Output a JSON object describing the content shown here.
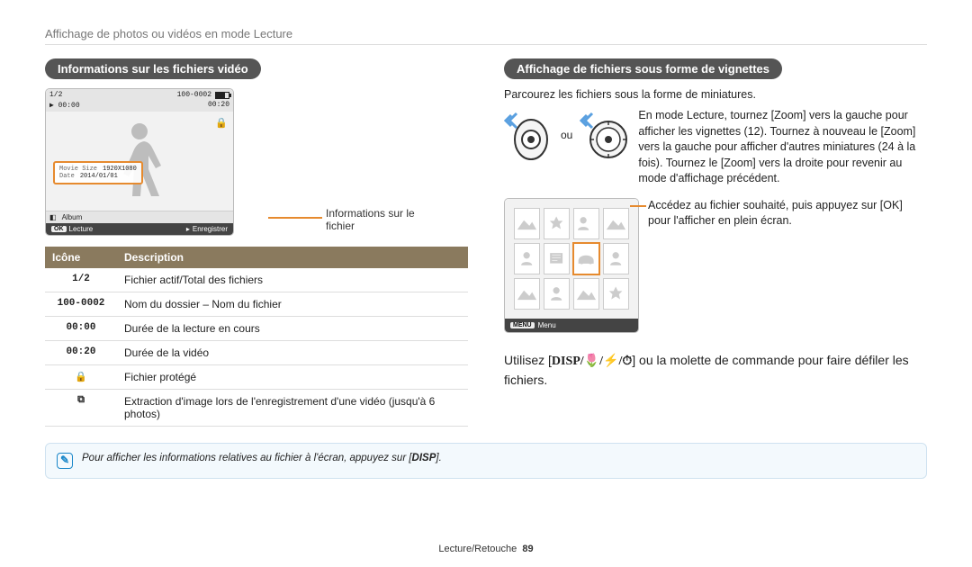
{
  "breadcrumb": "Affichage de photos ou vidéos en mode Lecture",
  "left": {
    "heading": "Informations sur les fichiers vidéo",
    "preview": {
      "index": "1/2",
      "folderfile": "100-0002",
      "elapsed": "00:00",
      "total": "00:20",
      "movie_label": "Movie Size",
      "movie_value": "1920X1080",
      "date_label": "Date",
      "date_value": "2014/01/01",
      "album": "Album",
      "play_key": "OK",
      "play_label": "Lecture",
      "save_label": "Enregistrer"
    },
    "callout": "Informations sur le\nfichier",
    "table": {
      "head_icon": "Icône",
      "head_desc": "Description",
      "rows": [
        {
          "icon": "1/2",
          "desc": "Fichier actif/Total des fichiers"
        },
        {
          "icon": "100-0002",
          "desc": "Nom du dossier – Nom du fichier"
        },
        {
          "icon": "00:00",
          "desc": "Durée de la lecture en cours"
        },
        {
          "icon": "00:20",
          "desc": "Durée de la vidéo"
        },
        {
          "icon": "🔒",
          "desc": "Fichier protégé"
        },
        {
          "icon": "⧉",
          "desc": "Extraction d'image lors de l'enregistrement d'une vidéo (jusqu'à 6 photos)"
        }
      ]
    },
    "tip": "Pour afficher les informations relatives au fichier à l'écran, appuyez sur [",
    "tip_key": "DISP",
    "tip_end": "]."
  },
  "right": {
    "heading": "Affichage de fichiers sous forme de vignettes",
    "intro": "Parcourez les fichiers sous la forme de miniatures.",
    "ou": "ou",
    "zoom_instr": "En mode Lecture, tournez [Zoom] vers la gauche pour afficher les vignettes (12). Tournez à nouveau le [Zoom] vers la gauche pour afficher d'autres miniatures (24 à la fois). Tournez le [Zoom] vers la droite pour revenir au mode d'affichage précédent.",
    "thumb_callout": "Accédez au fichier souhaité, puis appuyez sur [OK] pour l'afficher en plein écran.",
    "menu_key": "MENU",
    "menu_label": "Menu",
    "main_instr_pre": "Utilisez [",
    "main_instr_post": "] ou la molette de commande pour faire défiler les fichiers.",
    "keys": "DISP/🌷/⚡/⏱"
  },
  "footer": {
    "section": "Lecture/Retouche",
    "page": "89"
  }
}
